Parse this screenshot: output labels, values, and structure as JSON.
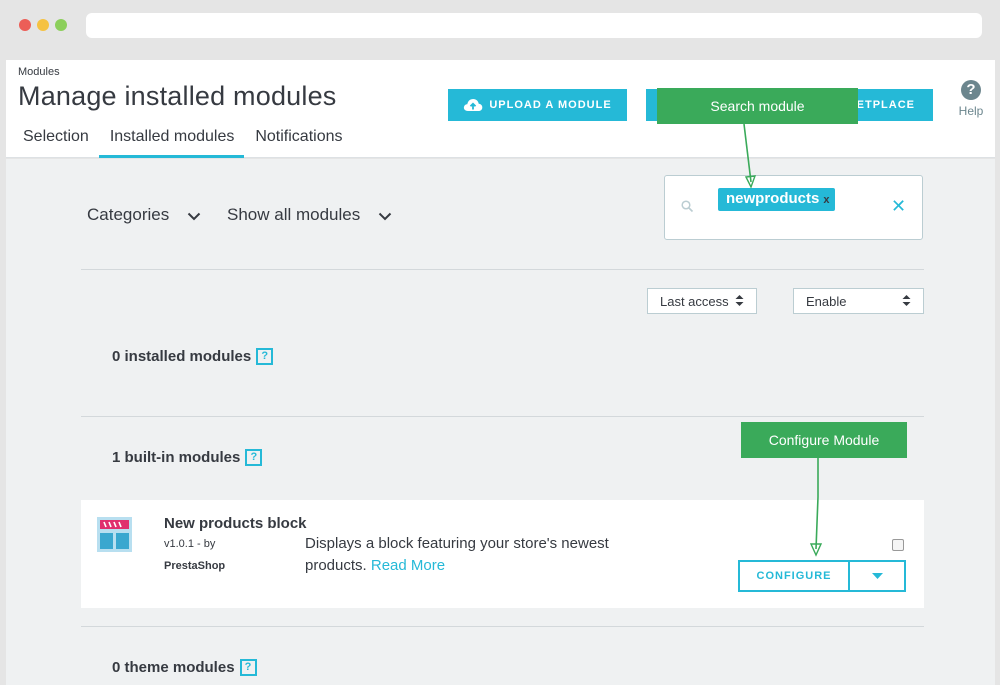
{
  "header": {
    "breadcrumb": "Modules",
    "title": "Manage installed modules",
    "upload_label": "UPLOAD A MODULE",
    "marketplace_label": "KETPLACE",
    "help_label": "Help"
  },
  "tabs": [
    {
      "label": "Selection",
      "active": false
    },
    {
      "label": "Installed modules",
      "active": true
    },
    {
      "label": "Notifications",
      "active": false
    }
  ],
  "filters": {
    "categories": "Categories",
    "show_all": "Show all modules"
  },
  "search": {
    "tag": "newproducts",
    "tag_remove": "x",
    "clear": "✕"
  },
  "selects": {
    "sort": "Last access",
    "status": "Enable"
  },
  "sections": {
    "installed": "0 installed modules",
    "builtin": "1 built-in modules",
    "theme": "0 theme modules",
    "help": "?"
  },
  "module": {
    "name": "New products block",
    "version": "v1.0.1 - by",
    "author": "PrestaShop",
    "description": "Displays a block featuring your store's newest products.",
    "read_more": "Read More",
    "configure_label": "CONFIGURE"
  },
  "callouts": {
    "search": "Search module",
    "configure": "Configure Module"
  },
  "colors": {
    "accent": "#25b9d7",
    "callout": "#3aaa5a"
  },
  "icons": [
    "cloud-upload-icon",
    "help-icon",
    "chevron-down-icon",
    "search-icon",
    "close-icon",
    "sort-arrows-icon",
    "module-logo-icon",
    "caret-down-icon"
  ]
}
